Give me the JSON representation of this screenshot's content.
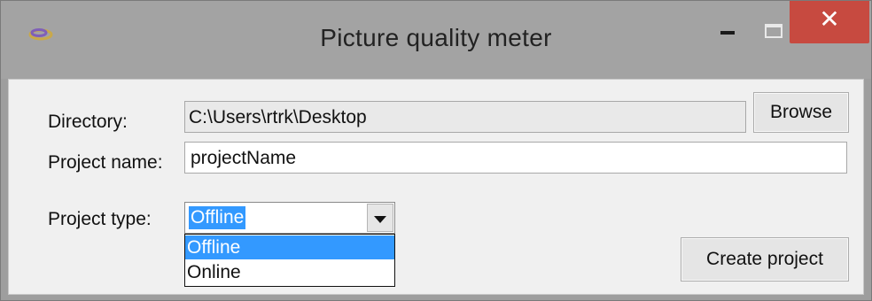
{
  "window": {
    "title": "Picture quality meter",
    "controls": {
      "minimize_icon": "minimize-icon",
      "maximize_icon": "maximize-icon",
      "close_glyph": "✕"
    }
  },
  "form": {
    "directory": {
      "label": "Directory:",
      "value": "C:\\Users\\rtrk\\Desktop"
    },
    "browse_button": "Browse",
    "project_name": {
      "label": "Project name:",
      "value": "projectName"
    },
    "project_type": {
      "label": "Project type:",
      "selected": "Offline",
      "options": [
        "Offline",
        "Online"
      ]
    },
    "create_button": "Create project"
  },
  "colors": {
    "title_bar": "#a3a3a3",
    "close_button": "#c74a40",
    "selection": "#3399ff",
    "client_background": "#f0f0f0"
  }
}
